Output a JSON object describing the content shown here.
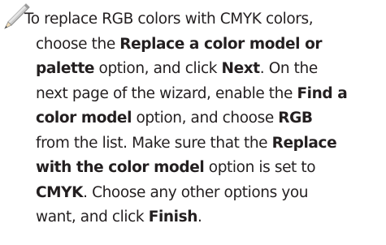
{
  "note": {
    "icon": "pencil-icon",
    "lines": [
      [
        {
          "text": "To replace RGB colors with CMYK colors,",
          "bold": false
        }
      ],
      [
        {
          "text": "choose the ",
          "bold": false
        },
        {
          "text": "Replace a color model or",
          "bold": true
        }
      ],
      [
        {
          "text": "palette",
          "bold": true
        },
        {
          "text": " option, and click ",
          "bold": false
        },
        {
          "text": "Next",
          "bold": true
        },
        {
          "text": ". On the",
          "bold": false
        }
      ],
      [
        {
          "text": "next page of the wizard, enable the ",
          "bold": false
        },
        {
          "text": "Find a",
          "bold": true
        }
      ],
      [
        {
          "text": "color model",
          "bold": true
        },
        {
          "text": " option, and choose ",
          "bold": false
        },
        {
          "text": "RGB",
          "bold": true
        }
      ],
      [
        {
          "text": "from the list. Make sure that the ",
          "bold": false
        },
        {
          "text": "Replace",
          "bold": true
        }
      ],
      [
        {
          "text": "with the color model",
          "bold": true
        },
        {
          "text": " option is set to",
          "bold": false
        }
      ],
      [
        {
          "text": "CMYK",
          "bold": true
        },
        {
          "text": ". Choose any other options you",
          "bold": false
        }
      ],
      [
        {
          "text": "want, and click ",
          "bold": false
        },
        {
          "text": "Finish",
          "bold": true
        },
        {
          "text": ".",
          "bold": false
        }
      ]
    ]
  }
}
